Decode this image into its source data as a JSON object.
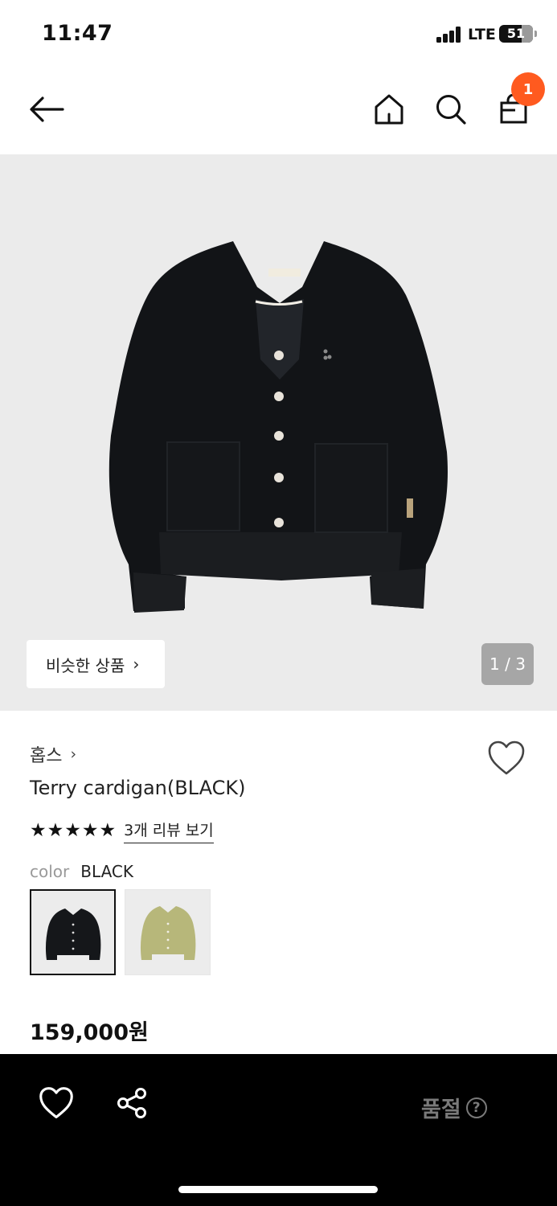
{
  "status_bar": {
    "time": "11:47",
    "network": "LTE",
    "battery": "51"
  },
  "header": {
    "back_icon": "arrow-left-icon",
    "home_icon": "home-icon",
    "search_icon": "search-icon",
    "bag_icon": "shopping-bag-icon",
    "cart_count": "1",
    "badge_color": "#ff5a1f"
  },
  "gallery": {
    "similar_label": "비슷한 상품",
    "counter": "1 / 3",
    "current_image": 1,
    "total_images": 3,
    "background_color": "#ebebeb"
  },
  "product": {
    "brand": "홉스",
    "name": "Terry cardigan(BLACK)",
    "rating": 5,
    "rating_max": 5,
    "review_link": "3개 리뷰 보기",
    "color_label": "color",
    "color_value": "BLACK",
    "swatches": [
      {
        "name": "BLACK",
        "color": "#15171a",
        "selected": true
      },
      {
        "name": "OLIVE",
        "color": "#b7b77a",
        "selected": false
      }
    ],
    "price": "159,000원",
    "wishlist_icon": "heart-outline-icon"
  },
  "bottom_bar": {
    "heart_icon": "heart-outline-icon",
    "share_icon": "share-icon",
    "soldout_label": "품절",
    "help_icon": "question-circle-icon",
    "background_color": "#000000"
  }
}
